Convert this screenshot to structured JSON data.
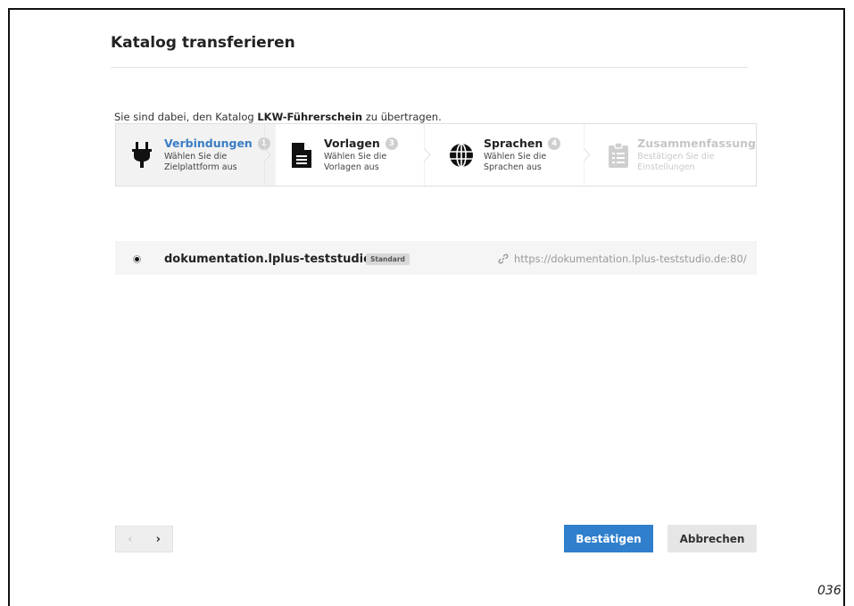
{
  "dialog": {
    "title": "Katalog transferieren",
    "intro_prefix": "Sie sind dabei, den Katalog ",
    "catalog_name": "LKW-Führerschein",
    "intro_suffix": " zu übertragen."
  },
  "wizard": {
    "steps": [
      {
        "name": "Verbindungen",
        "badge": "1",
        "desc": "Wählen Sie die Zielplattform aus",
        "icon": "plug-icon",
        "state": "active"
      },
      {
        "name": "Vorlagen",
        "badge": "3",
        "desc": "Wählen Sie die Vorlagen aus",
        "icon": "document-icon",
        "state": "normal"
      },
      {
        "name": "Sprachen",
        "badge": "4",
        "desc": "Wählen Sie die Sprachen aus",
        "icon": "globe-icon",
        "state": "normal"
      },
      {
        "name": "Zusammenfassung",
        "badge": "",
        "desc": "Bestätigen Sie die Einstellungen",
        "icon": "clipboard-list-icon",
        "state": "disabled"
      }
    ]
  },
  "connection": {
    "name": "dokumentation.lplus-teststudio.de",
    "tag": "Standard",
    "url": "https://dokumentation.lplus-teststudio.de:80/",
    "selected": true
  },
  "footer": {
    "prev": "‹",
    "next": "›",
    "confirm_label": "Bestätigen",
    "cancel_label": "Abbrechen"
  },
  "page_number": "036",
  "colors": {
    "accent": "#2f7fcd",
    "active_step": "#3b7dc4"
  }
}
